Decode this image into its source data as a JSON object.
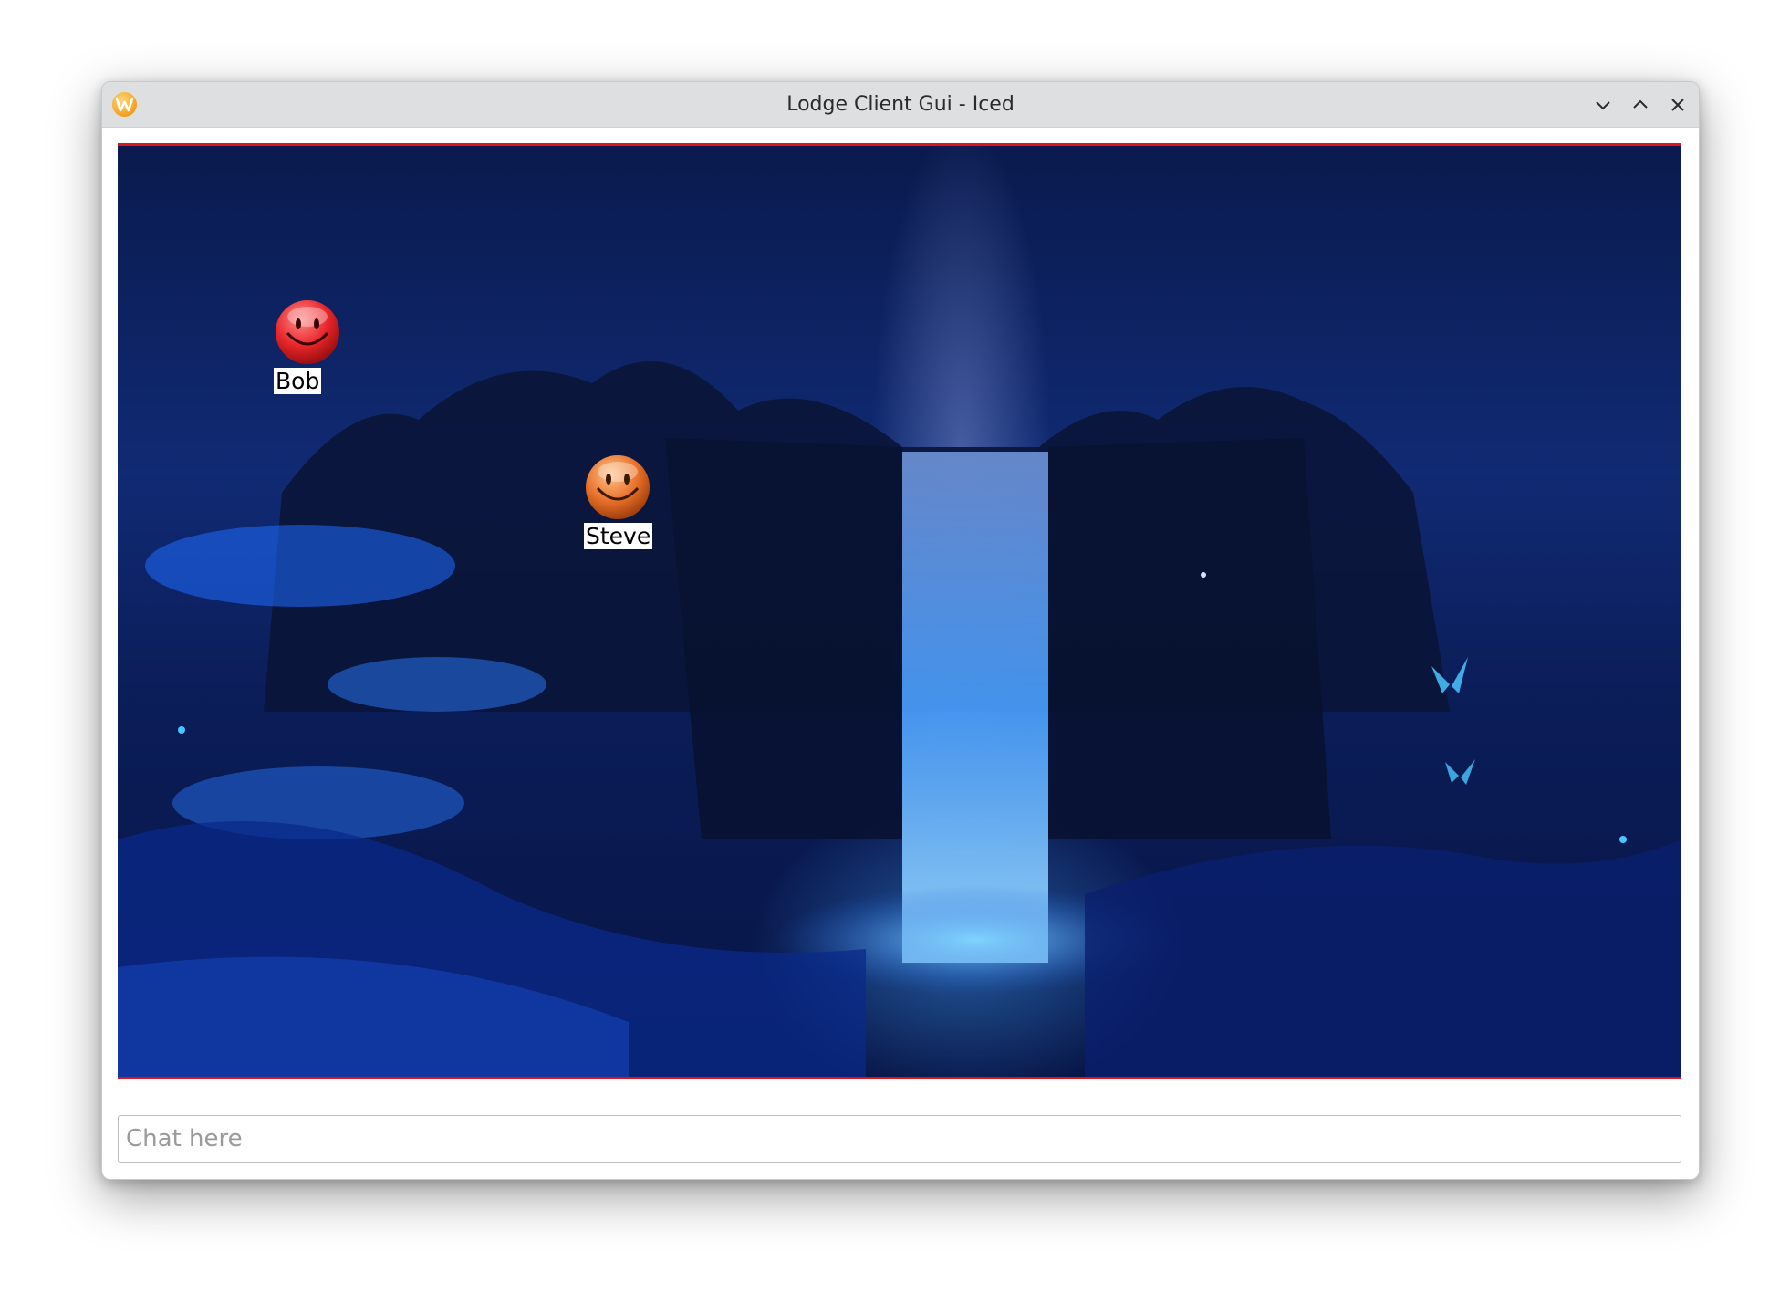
{
  "window": {
    "title": "Lodge Client Gui - Iced",
    "controls": {
      "minimize_icon": "chevron-down-icon",
      "maximize_icon": "chevron-up-icon",
      "close_icon": "close-icon"
    }
  },
  "scene": {
    "border_color": "#e0121c",
    "avatars": [
      {
        "name": "Bob",
        "color": "#e8262a"
      },
      {
        "name": "Steve",
        "color": "#e8702a"
      }
    ]
  },
  "chat": {
    "placeholder": "Chat here",
    "value": ""
  }
}
